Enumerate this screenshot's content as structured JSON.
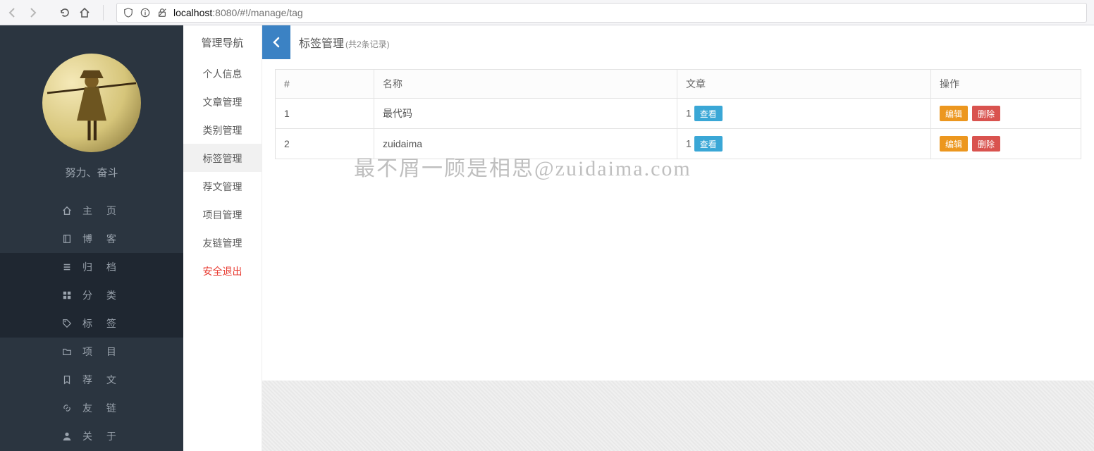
{
  "browser": {
    "url_prefix": "localhost",
    "url_port": ":8080",
    "url_path": "/#!/manage/tag"
  },
  "sidebar_left": {
    "tagline": "努力、奋斗",
    "items": [
      {
        "icon": "home",
        "label": "主 页",
        "sub": false
      },
      {
        "icon": "book",
        "label": "博 客",
        "sub": false
      },
      {
        "icon": "list",
        "label": "归 档",
        "sub": true
      },
      {
        "icon": "grid",
        "label": "分 类",
        "sub": true
      },
      {
        "icon": "tag",
        "label": "标 签",
        "sub": true
      },
      {
        "icon": "folder",
        "label": "项 目",
        "sub": false
      },
      {
        "icon": "bookmark",
        "label": "荐 文",
        "sub": false
      },
      {
        "icon": "link",
        "label": "友 链",
        "sub": false
      },
      {
        "icon": "user",
        "label": "关 于",
        "sub": false
      }
    ]
  },
  "sidebar_manage": {
    "title": "管理导航",
    "items": [
      {
        "label": "个人信息",
        "active": false,
        "danger": false
      },
      {
        "label": "文章管理",
        "active": false,
        "danger": false
      },
      {
        "label": "类别管理",
        "active": false,
        "danger": false
      },
      {
        "label": "标签管理",
        "active": true,
        "danger": false
      },
      {
        "label": "荐文管理",
        "active": false,
        "danger": false
      },
      {
        "label": "项目管理",
        "active": false,
        "danger": false
      },
      {
        "label": "友链管理",
        "active": false,
        "danger": false
      },
      {
        "label": "安全退出",
        "active": false,
        "danger": true
      }
    ]
  },
  "main": {
    "title": "标签管理",
    "subtitle": "(共2条记录)",
    "columns": {
      "idx": "#",
      "name": "名称",
      "article": "文章",
      "ops": "操作"
    },
    "view_label": "查看",
    "edit_label": "编辑",
    "delete_label": "删除",
    "rows": [
      {
        "idx": "1",
        "name": "最代码",
        "article_count": "1"
      },
      {
        "idx": "2",
        "name": "zuidaima",
        "article_count": "1"
      }
    ]
  },
  "watermark": "最不屑一顾是相思@zuidaima.com"
}
